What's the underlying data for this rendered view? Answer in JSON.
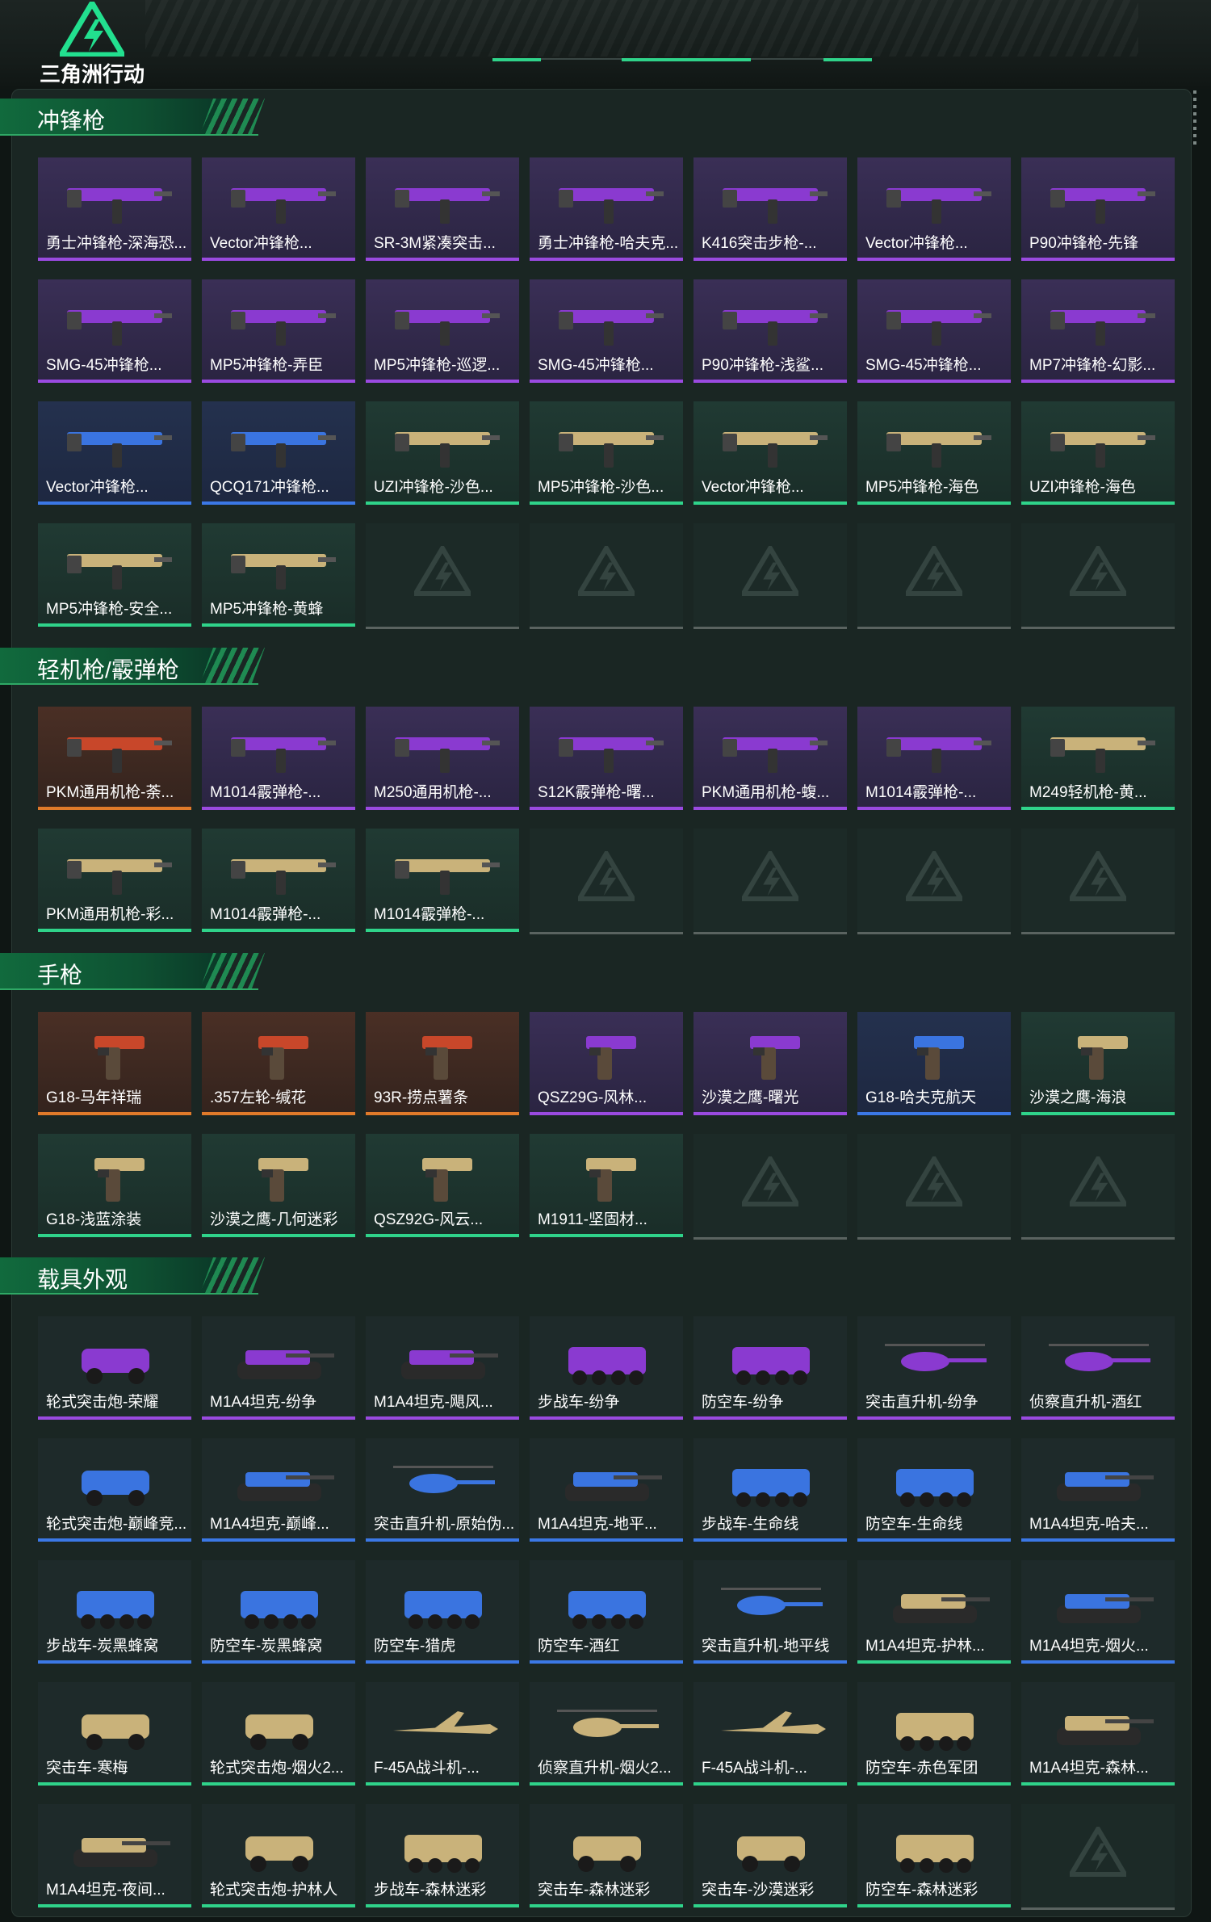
{
  "header": {
    "app_title": "三角洲行动"
  },
  "sections": [
    {
      "title": "冲锋枪",
      "items": [
        {
          "label": "勇士冲锋枪-深海恐...",
          "rarity": "purple",
          "icon": "smg-icon"
        },
        {
          "label": "Vector冲锋枪...",
          "rarity": "purple",
          "icon": "smg-icon"
        },
        {
          "label": "SR-3M紧凑突击...",
          "rarity": "purple",
          "icon": "smg-icon"
        },
        {
          "label": "勇士冲锋枪-哈夫克...",
          "rarity": "purple",
          "icon": "smg-icon"
        },
        {
          "label": "K416突击步枪-...",
          "rarity": "purple",
          "icon": "rifle-icon"
        },
        {
          "label": "Vector冲锋枪...",
          "rarity": "purple",
          "icon": "smg-icon"
        },
        {
          "label": "P90冲锋枪-先锋",
          "rarity": "purple",
          "icon": "smg-icon"
        },
        {
          "label": "SMG-45冲锋枪...",
          "rarity": "purple",
          "icon": "smg-icon"
        },
        {
          "label": "MP5冲锋枪-弄臣",
          "rarity": "purple",
          "icon": "smg-icon"
        },
        {
          "label": "MP5冲锋枪-巡逻...",
          "rarity": "purple",
          "icon": "smg-icon"
        },
        {
          "label": "SMG-45冲锋枪...",
          "rarity": "purple",
          "icon": "smg-icon"
        },
        {
          "label": "P90冲锋枪-浅鲨...",
          "rarity": "purple",
          "icon": "smg-icon"
        },
        {
          "label": "SMG-45冲锋枪...",
          "rarity": "purple",
          "icon": "smg-icon"
        },
        {
          "label": "MP7冲锋枪-幻影...",
          "rarity": "purple",
          "icon": "smg-icon"
        },
        {
          "label": "Vector冲锋枪...",
          "rarity": "blue",
          "icon": "smg-icon"
        },
        {
          "label": "QCQ171冲锋枪...",
          "rarity": "blue",
          "icon": "smg-icon"
        },
        {
          "label": "UZI冲锋枪-沙色...",
          "rarity": "green",
          "icon": "smg-icon"
        },
        {
          "label": "MP5冲锋枪-沙色...",
          "rarity": "green",
          "icon": "smg-icon"
        },
        {
          "label": "Vector冲锋枪...",
          "rarity": "green",
          "icon": "smg-icon"
        },
        {
          "label": "MP5冲锋枪-海色",
          "rarity": "green",
          "icon": "smg-icon"
        },
        {
          "label": "UZI冲锋枪-海色",
          "rarity": "green",
          "icon": "smg-icon"
        },
        {
          "label": "MP5冲锋枪-安全...",
          "rarity": "green",
          "icon": "smg-icon"
        },
        {
          "label": "MP5冲锋枪-黄蜂",
          "rarity": "green",
          "icon": "smg-icon"
        }
      ]
    },
    {
      "title": "轻机枪/霰弹枪",
      "items": [
        {
          "label": "PKM通用机枪-荼...",
          "rarity": "orange",
          "icon": "lmg-icon"
        },
        {
          "label": "M1014霰弹枪-...",
          "rarity": "purple",
          "icon": "shotgun-icon"
        },
        {
          "label": "M250通用机枪-...",
          "rarity": "purple",
          "icon": "lmg-icon"
        },
        {
          "label": "S12K霰弹枪-曙...",
          "rarity": "purple",
          "icon": "shotgun-icon"
        },
        {
          "label": "PKM通用机枪-蝮...",
          "rarity": "purple",
          "icon": "lmg-icon"
        },
        {
          "label": "M1014霰弹枪-...",
          "rarity": "purple",
          "icon": "shotgun-icon"
        },
        {
          "label": "M249轻机枪-黄...",
          "rarity": "green",
          "icon": "lmg-icon"
        },
        {
          "label": "PKM通用机枪-彩...",
          "rarity": "green",
          "icon": "lmg-icon"
        },
        {
          "label": "M1014霰弹枪-...",
          "rarity": "green",
          "icon": "shotgun-icon"
        },
        {
          "label": "M1014霰弹枪-...",
          "rarity": "green",
          "icon": "shotgun-icon"
        }
      ]
    },
    {
      "title": "手枪",
      "items": [
        {
          "label": "G18-马年祥瑞",
          "rarity": "orange",
          "icon": "pistol-icon"
        },
        {
          "label": ".357左轮-缄花",
          "rarity": "orange",
          "icon": "revolver-icon"
        },
        {
          "label": "93R-捞点薯条",
          "rarity": "orange",
          "icon": "pistol-icon"
        },
        {
          "label": "QSZ29G-风林...",
          "rarity": "purple",
          "icon": "pistol-icon"
        },
        {
          "label": "沙漠之鹰-曙光",
          "rarity": "purple",
          "icon": "pistol-icon"
        },
        {
          "label": "G18-哈夫克航天",
          "rarity": "blue",
          "icon": "pistol-icon"
        },
        {
          "label": "沙漠之鹰-海浪",
          "rarity": "green",
          "icon": "pistol-icon"
        },
        {
          "label": "G18-浅蓝涂装",
          "rarity": "green",
          "icon": "pistol-icon"
        },
        {
          "label": "沙漠之鹰-几何迷彩",
          "rarity": "green",
          "icon": "pistol-icon"
        },
        {
          "label": "QSZ92G-风云...",
          "rarity": "green",
          "icon": "pistol-icon"
        },
        {
          "label": "M1911-坚固材...",
          "rarity": "green",
          "icon": "pistol-icon"
        }
      ]
    },
    {
      "title": "载具外观",
      "items": [
        {
          "label": "轮式突击炮-荣耀",
          "rarity": "purple",
          "icon": "armored-car-icon"
        },
        {
          "label": "M1A4坦克-纷争",
          "rarity": "purple",
          "icon": "tank-icon"
        },
        {
          "label": "M1A4坦克-飓风...",
          "rarity": "purple",
          "icon": "tank-icon"
        },
        {
          "label": "步战车-纷争",
          "rarity": "purple",
          "icon": "apc-icon"
        },
        {
          "label": "防空车-纷争",
          "rarity": "purple",
          "icon": "apc-icon"
        },
        {
          "label": "突击直升机-纷争",
          "rarity": "purple",
          "icon": "helicopter-icon"
        },
        {
          "label": "侦察直升机-酒红",
          "rarity": "purple",
          "icon": "helicopter-icon"
        },
        {
          "label": "轮式突击炮-巅峰竞...",
          "rarity": "blue",
          "icon": "armored-car-icon"
        },
        {
          "label": "M1A4坦克-巅峰...",
          "rarity": "blue",
          "icon": "tank-icon"
        },
        {
          "label": "突击直升机-原始伪...",
          "rarity": "blue",
          "icon": "helicopter-icon"
        },
        {
          "label": "M1A4坦克-地平...",
          "rarity": "blue",
          "icon": "tank-icon"
        },
        {
          "label": "步战车-生命线",
          "rarity": "blue",
          "icon": "apc-icon"
        },
        {
          "label": "防空车-生命线",
          "rarity": "blue",
          "icon": "apc-icon"
        },
        {
          "label": "M1A4坦克-哈夫...",
          "rarity": "blue",
          "icon": "tank-icon"
        },
        {
          "label": "步战车-炭黑蜂窝",
          "rarity": "blue",
          "icon": "apc-icon"
        },
        {
          "label": "防空车-炭黑蜂窝",
          "rarity": "blue",
          "icon": "apc-icon"
        },
        {
          "label": "防空车-猎虎",
          "rarity": "blue",
          "icon": "apc-icon"
        },
        {
          "label": "防空车-酒红",
          "rarity": "blue",
          "icon": "apc-icon"
        },
        {
          "label": "突击直升机-地平线",
          "rarity": "blue",
          "icon": "helicopter-icon"
        },
        {
          "label": "M1A4坦克-护林...",
          "rarity": "green",
          "icon": "tank-icon"
        },
        {
          "label": "M1A4坦克-烟火...",
          "rarity": "blue",
          "icon": "tank-icon"
        },
        {
          "label": "突击车-寒梅",
          "rarity": "green",
          "icon": "armored-car-icon"
        },
        {
          "label": "轮式突击炮-烟火2...",
          "rarity": "green",
          "icon": "armored-car-icon"
        },
        {
          "label": "F-45A战斗机-...",
          "rarity": "green",
          "icon": "jet-icon"
        },
        {
          "label": "侦察直升机-烟火2...",
          "rarity": "green",
          "icon": "helicopter-icon"
        },
        {
          "label": "F-45A战斗机-...",
          "rarity": "green",
          "icon": "jet-icon"
        },
        {
          "label": "防空车-赤色军团",
          "rarity": "green",
          "icon": "apc-icon"
        },
        {
          "label": "M1A4坦克-森林...",
          "rarity": "green",
          "icon": "tank-icon"
        },
        {
          "label": "M1A4坦克-夜间...",
          "rarity": "green",
          "icon": "tank-icon"
        },
        {
          "label": "轮式突击炮-护林人",
          "rarity": "green",
          "icon": "armored-car-icon"
        },
        {
          "label": "步战车-森林迷彩",
          "rarity": "green",
          "icon": "apc-icon"
        },
        {
          "label": "突击车-森林迷彩",
          "rarity": "green",
          "icon": "armored-car-icon"
        },
        {
          "label": "突击车-沙漠迷彩",
          "rarity": "green",
          "icon": "armored-car-icon"
        },
        {
          "label": "防空车-森林迷彩",
          "rarity": "green",
          "icon": "apc-icon"
        }
      ]
    }
  ],
  "colors": {
    "accent": "#2fd38a",
    "rarity_orange": "#e07a2a",
    "rarity_purple": "#9a4ae0",
    "rarity_blue": "#3b78e6",
    "rarity_green": "#2fd38a"
  }
}
